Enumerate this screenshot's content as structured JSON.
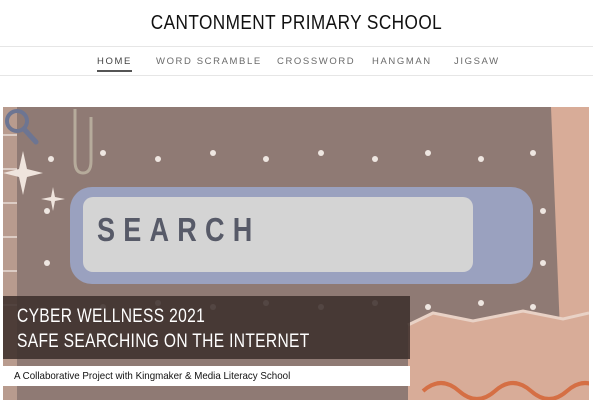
{
  "header": {
    "title": "CANTONMENT PRIMARY SCHOOL"
  },
  "nav": {
    "items": [
      {
        "label": "HOME",
        "active": true
      },
      {
        "label": "WORD SCRAMBLE",
        "active": false
      },
      {
        "label": "CROSSWORD",
        "active": false
      },
      {
        "label": "HANGMAN",
        "active": false
      },
      {
        "label": "JIGSAW",
        "active": false
      }
    ]
  },
  "hero": {
    "search_text": "SEARCH",
    "caption_line1": "CYBER WELLNESS 2021",
    "caption_line2": "SAFE SEARCHING ON THE INTERNET",
    "subcaption": "A Collaborative Project with Kingmaker & Media Literacy School",
    "colors": {
      "background": "#8f7a74",
      "search_frame": "#9aa1bf",
      "search_field": "#d4d4d4",
      "peach": "#d8ac98",
      "wave": "#d56f44"
    }
  }
}
